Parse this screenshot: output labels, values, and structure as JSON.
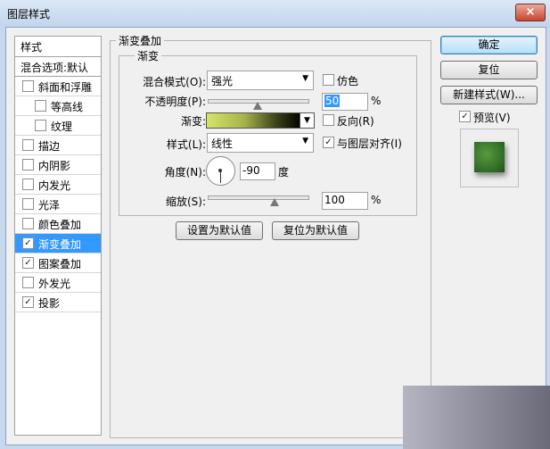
{
  "window": {
    "title": "图层样式",
    "close_symbol": "×"
  },
  "styles_panel": {
    "header": "样式",
    "blend_options": "混合选项:默认",
    "items": [
      {
        "label": "斜面和浮雕",
        "checked": false,
        "selected": false,
        "indent": false
      },
      {
        "label": "等高线",
        "checked": false,
        "selected": false,
        "indent": true
      },
      {
        "label": "纹理",
        "checked": false,
        "selected": false,
        "indent": true
      },
      {
        "label": "描边",
        "checked": false,
        "selected": false,
        "indent": false
      },
      {
        "label": "内阴影",
        "checked": false,
        "selected": false,
        "indent": false
      },
      {
        "label": "内发光",
        "checked": false,
        "selected": false,
        "indent": false
      },
      {
        "label": "光泽",
        "checked": false,
        "selected": false,
        "indent": false
      },
      {
        "label": "颜色叠加",
        "checked": false,
        "selected": false,
        "indent": false
      },
      {
        "label": "渐变叠加",
        "checked": true,
        "selected": true,
        "indent": false
      },
      {
        "label": "图案叠加",
        "checked": true,
        "selected": false,
        "indent": false
      },
      {
        "label": "外发光",
        "checked": false,
        "selected": false,
        "indent": false
      },
      {
        "label": "投影",
        "checked": true,
        "selected": false,
        "indent": false
      }
    ]
  },
  "gradient_overlay": {
    "group_title": "渐变叠加",
    "subgroup_title": "渐变",
    "blend_mode": {
      "label": "混合模式(O):",
      "value": "强光"
    },
    "dither": {
      "label": "仿色",
      "checked": false
    },
    "opacity": {
      "label": "不透明度(P):",
      "value": "50",
      "unit": "%",
      "percent": 50
    },
    "gradient": {
      "label": "渐变:",
      "colors": [
        "#d6e36a",
        "#a8b44a",
        "#3c4218",
        "#050500"
      ]
    },
    "reverse": {
      "label": "反向(R)",
      "checked": false
    },
    "style": {
      "label": "样式(L):",
      "value": "线性"
    },
    "align_with_layer": {
      "label": "与图层对齐(I)",
      "checked": true
    },
    "angle": {
      "label": "角度(N):",
      "value": "-90",
      "unit": "度"
    },
    "scale": {
      "label": "缩放(S):",
      "value": "100",
      "unit": "%",
      "percent": 100
    },
    "make_default": "设置为默认值",
    "reset_default": "复位为默认值"
  },
  "actions": {
    "ok": "确定",
    "reset": "复位",
    "new_style": "新建样式(W)...",
    "preview": {
      "label": "预览(V)",
      "checked": true
    }
  },
  "check_mark": "✓",
  "dropdown_arrow": "▼"
}
